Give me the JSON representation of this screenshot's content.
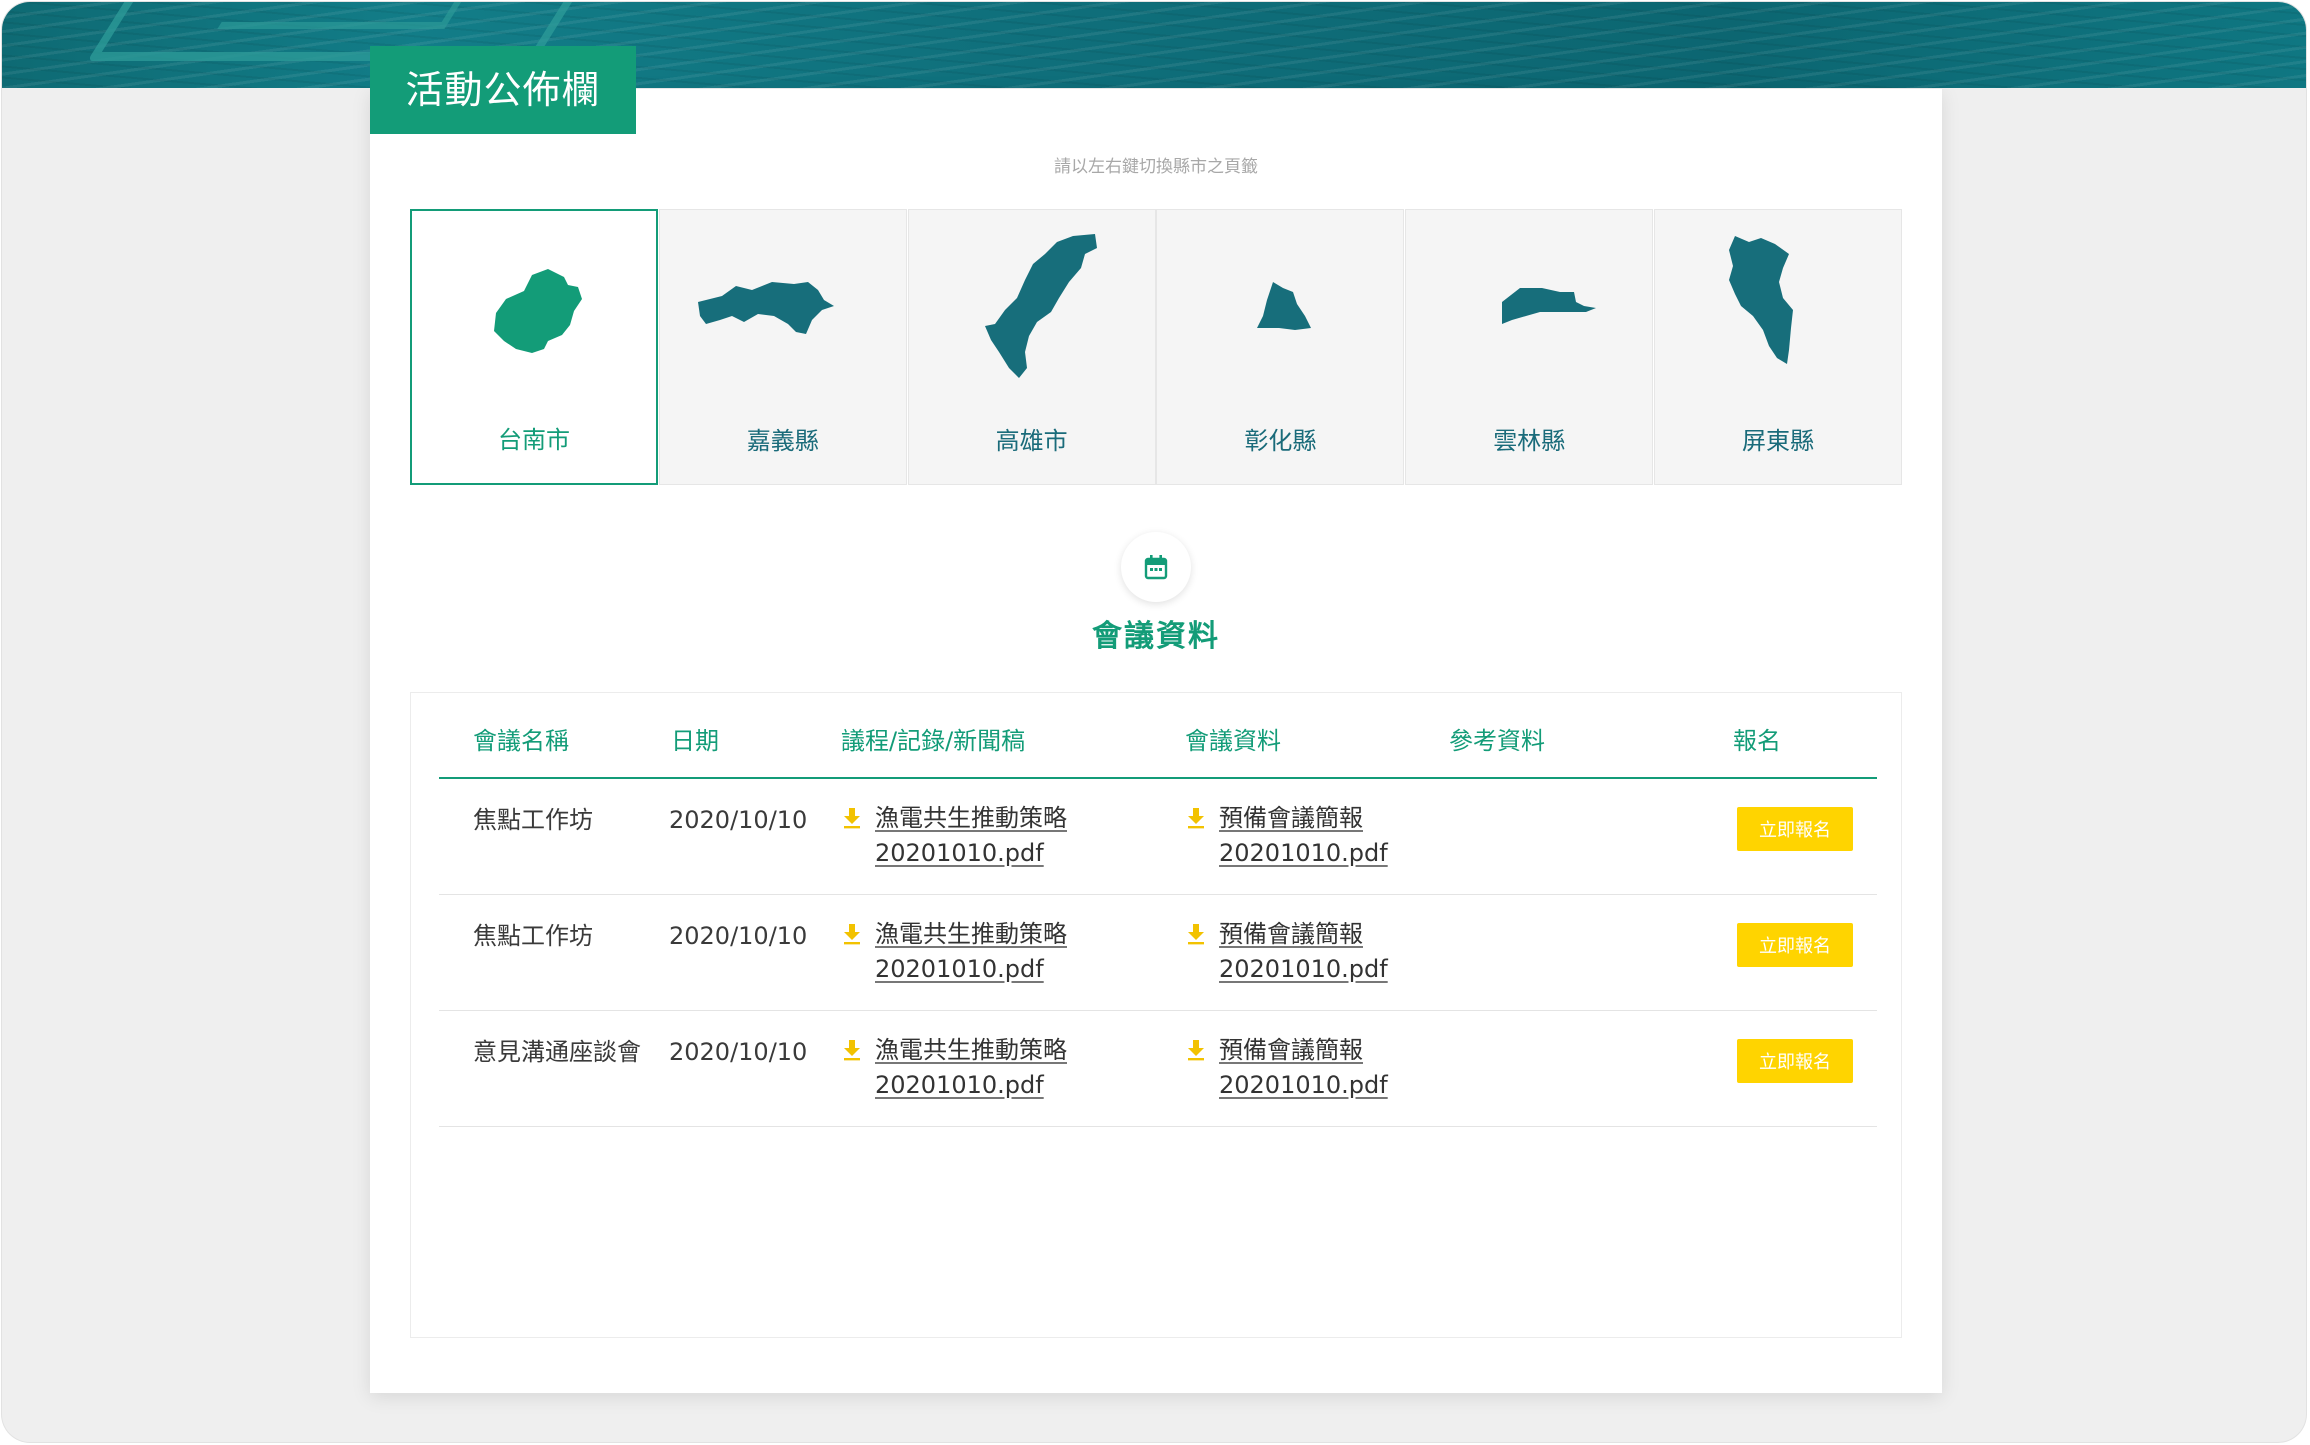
{
  "page": {
    "title": "活動公佈欄",
    "hint": "請以左右鍵切換縣市之頁籤"
  },
  "regions": [
    {
      "label": "台南市",
      "active": true
    },
    {
      "label": "嘉義縣",
      "active": false
    },
    {
      "label": "高雄市",
      "active": false
    },
    {
      "label": "彰化縣",
      "active": false
    },
    {
      "label": "雲林縣",
      "active": false
    },
    {
      "label": "屏東縣",
      "active": false
    }
  ],
  "section": {
    "icon": "calendar-icon",
    "title": "會議資料"
  },
  "table": {
    "headers": {
      "name": "會議名稱",
      "date": "日期",
      "agenda": "議程/記錄/新聞稿",
      "materials": "會議資料",
      "reference": "參考資料",
      "signup": "報名"
    },
    "rows": [
      {
        "name": "焦點工作坊",
        "date": "2020/10/10",
        "agenda_line1": "漁電共生推動策略",
        "agenda_line2": "20201010.pdf",
        "materials_line1": "預備會議簡報",
        "materials_line2": "20201010.pdf",
        "signup": "立即報名"
      },
      {
        "name": "焦點工作坊",
        "date": "2020/10/10",
        "agenda_line1": "漁電共生推動策略",
        "agenda_line2": "20201010.pdf",
        "materials_line1": "預備會議簡報",
        "materials_line2": "20201010.pdf",
        "signup": "立即報名"
      },
      {
        "name": "意見溝通座談會",
        "date": "2020/10/10",
        "agenda_line1": "漁電共生推動策略",
        "agenda_line2": "20201010.pdf",
        "materials_line1": "預備會議簡報",
        "materials_line2": "20201010.pdf",
        "signup": "立即報名"
      }
    ]
  },
  "colors": {
    "primary": "#139c78",
    "map_fill": "#176e7b",
    "button": "#ffd400",
    "download_icon": "#f2c200"
  }
}
